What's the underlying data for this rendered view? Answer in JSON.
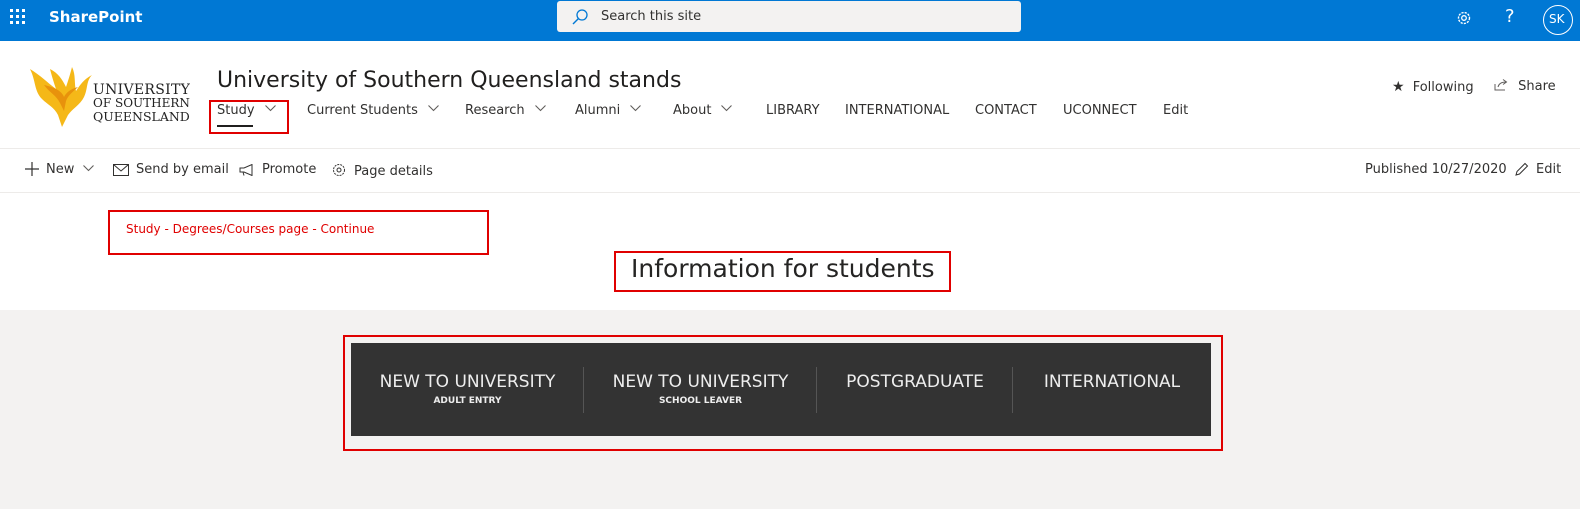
{
  "suite_bar": {
    "app_name": "SharePoint",
    "search_placeholder": "Search this site",
    "avatar_initials": "SK"
  },
  "site": {
    "title": "University of Southern Queensland stands",
    "logo_lines": [
      "UNIVERSITY",
      "OF SOUTHERN",
      "QUEENSLAND"
    ],
    "nav": [
      {
        "label": "Study",
        "has_menu": true,
        "active": true
      },
      {
        "label": "Current Students",
        "has_menu": true
      },
      {
        "label": "Research",
        "has_menu": true
      },
      {
        "label": "Alumni",
        "has_menu": true
      },
      {
        "label": "About",
        "has_menu": true
      },
      {
        "label": "LIBRARY",
        "has_menu": false
      },
      {
        "label": "INTERNATIONAL",
        "has_menu": false
      },
      {
        "label": "CONTACT",
        "has_menu": false
      },
      {
        "label": "UCONNECT",
        "has_menu": false
      },
      {
        "label": "Edit",
        "has_menu": false
      }
    ],
    "following_label": "Following",
    "share_label": "Share"
  },
  "command_bar": {
    "new_label": "New",
    "email_label": "Send by email",
    "promote_label": "Promote",
    "details_label": "Page details",
    "published_label": "Published 10/27/2020",
    "edit_label": "Edit"
  },
  "content": {
    "study_link": "Study - Degrees/Courses page - Continue",
    "heading": "Information for students",
    "tiles": [
      {
        "title": "NEW TO UNIVERSITY",
        "subtitle": "ADULT ENTRY"
      },
      {
        "title": "NEW TO UNIVERSITY",
        "subtitle": "SCHOOL LEAVER"
      },
      {
        "title": "POSTGRADUATE",
        "subtitle": ""
      },
      {
        "title": "INTERNATIONAL",
        "subtitle": ""
      }
    ]
  },
  "colors": {
    "suite_bar": "#0078d4",
    "annotation_red": "#e00000",
    "tile_bg": "#333333",
    "page_gray": "#f3f2f1"
  }
}
